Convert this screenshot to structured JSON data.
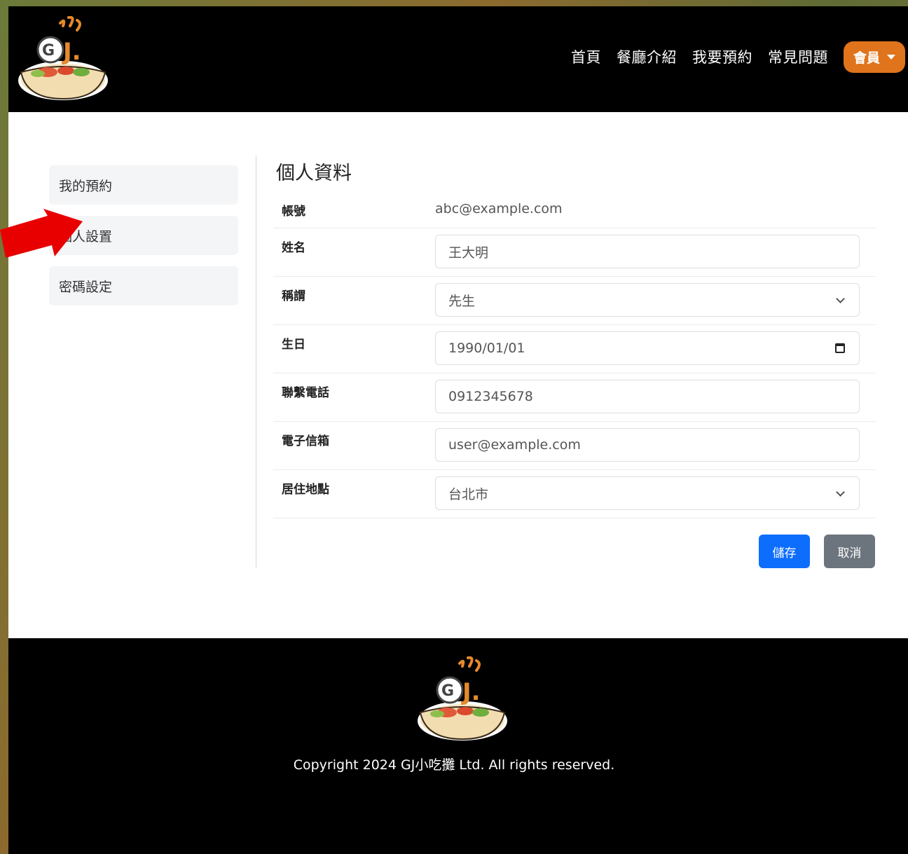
{
  "header": {
    "nav": [
      "首頁",
      "餐廳介紹",
      "我要預約",
      "常見問題"
    ],
    "member_label": "會員",
    "logo_text": "GJ."
  },
  "sidebar": {
    "items": [
      {
        "label": "我的預約"
      },
      {
        "label": "個人設置"
      },
      {
        "label": "密碼設定"
      }
    ]
  },
  "form": {
    "title": "個人資料",
    "account": {
      "label": "帳號",
      "value": "abc@example.com"
    },
    "name": {
      "label": "姓名",
      "value": "王大明"
    },
    "title_field": {
      "label": "稱謂",
      "value": "先生"
    },
    "birthday": {
      "label": "生日",
      "value": "1990/01/01"
    },
    "phone": {
      "label": "聯繫電話",
      "value": "0912345678"
    },
    "email": {
      "label": "電子信箱",
      "value": "user@example.com"
    },
    "city": {
      "label": "居住地點",
      "value": "台北市"
    },
    "save_label": "儲存",
    "cancel_label": "取消"
  },
  "footer": {
    "copyright": "Copyright 2024 GJ小吃攤 Ltd. All rights reserved."
  },
  "colors": {
    "accent": "#e0741c",
    "primary_button": "#0d6efd",
    "secondary_button": "#6c757d",
    "annotation_arrow": "#e80000"
  }
}
